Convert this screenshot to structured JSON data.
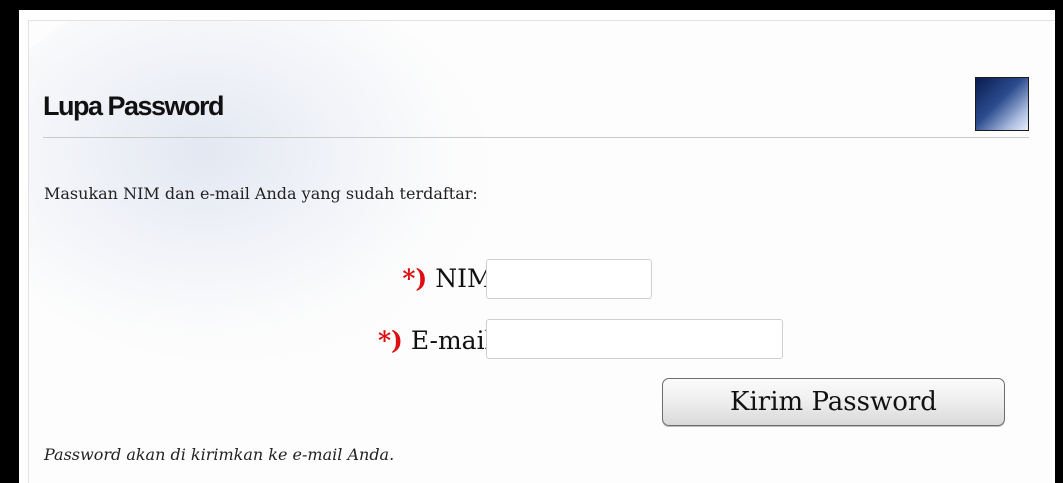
{
  "form": {
    "title": "Lupa Password",
    "instruction": "Masukan NIM dan e-mail Anda yang sudah terdaftar:",
    "required_marker": "*)",
    "nim_label": "NIM:",
    "nim_value": "",
    "email_label": "E-mail:",
    "email_value": "",
    "submit_label": "Kirim Password",
    "note": "Password akan di kirimkan ke e-mail Anda.",
    "icon": "header-gradient-icon",
    "colors": {
      "required": "#dd0f0f",
      "icon_dark": "#0a1c4f",
      "icon_light": "#e6edf8"
    }
  }
}
